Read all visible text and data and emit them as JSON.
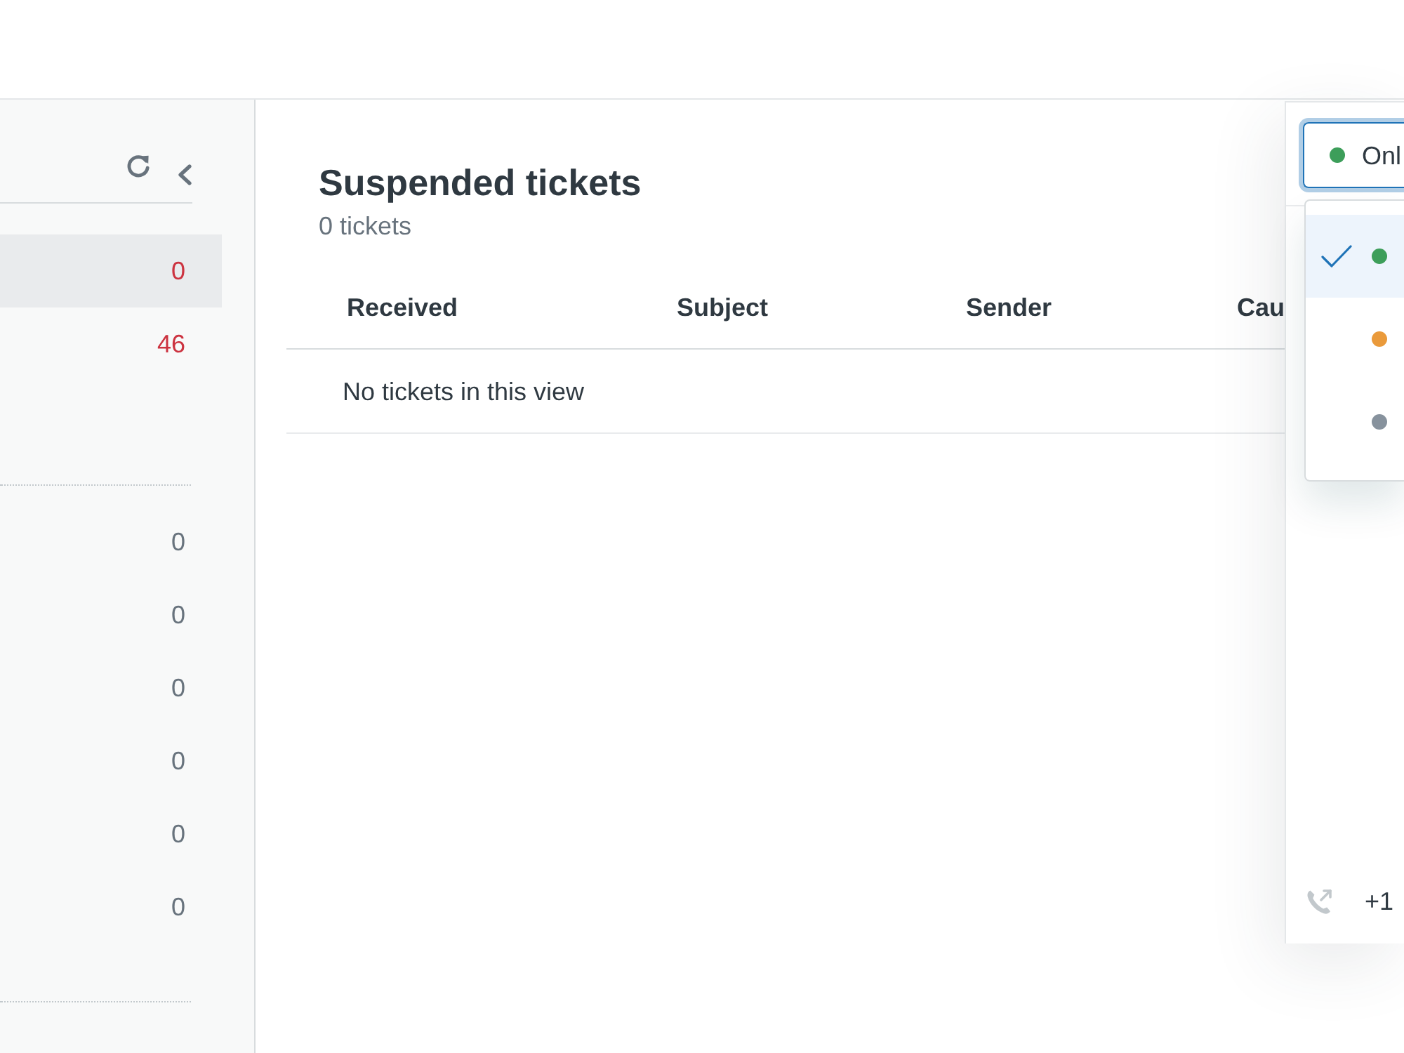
{
  "sidebar": {
    "sections": [
      {
        "items": [
          {
            "count": "0",
            "selected": true,
            "alert": true
          },
          {
            "count": "46",
            "selected": false,
            "alert": true
          }
        ]
      },
      {
        "items": [
          {
            "count": "0",
            "selected": false,
            "alert": false
          },
          {
            "count": "0",
            "selected": false,
            "alert": false
          },
          {
            "count": "0",
            "selected": false,
            "alert": false
          },
          {
            "count": "0",
            "selected": false,
            "alert": false
          },
          {
            "count": "0",
            "selected": false,
            "alert": false
          },
          {
            "count": "0",
            "selected": false,
            "alert": false
          }
        ]
      }
    ]
  },
  "main": {
    "title": "Suspended tickets",
    "subtitle": "0 tickets",
    "table": {
      "columns": [
        "Received",
        "Subject",
        "Sender",
        "Cau"
      ],
      "empty_message": "No tickets in this view"
    }
  },
  "status_panel": {
    "select": {
      "value": "Onl",
      "color": "#3d9e5a"
    },
    "options": [
      {
        "color": "#3d9e5a",
        "selected": true
      },
      {
        "color": "#ea9a3b",
        "selected": false
      },
      {
        "color": "#87929d",
        "selected": false
      }
    ],
    "phone": {
      "number": "+1"
    }
  }
}
